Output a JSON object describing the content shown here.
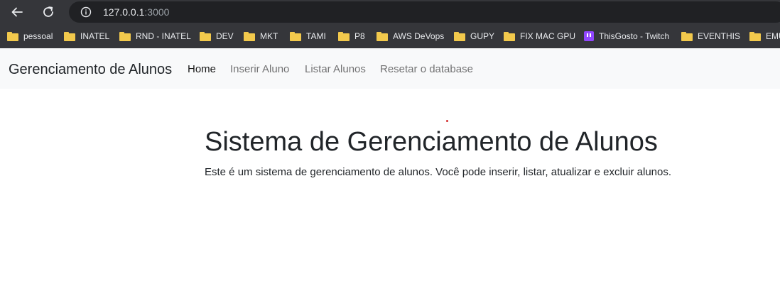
{
  "browser": {
    "url_host": "127.0.0.1",
    "url_port": ":3000",
    "bookmarks": [
      {
        "label": "pessoal",
        "icon": "folder-icon"
      },
      {
        "label": "INATEL",
        "icon": "folder-icon"
      },
      {
        "label": "RND - INATEL",
        "icon": "folder-icon"
      },
      {
        "label": "DEV",
        "icon": "folder-icon"
      },
      {
        "label": "MKT",
        "icon": "folder-icon"
      },
      {
        "label": "TAMI",
        "icon": "folder-icon"
      },
      {
        "label": "P8",
        "icon": "folder-icon"
      },
      {
        "label": "AWS DeVops",
        "icon": "folder-icon"
      },
      {
        "label": "GUPY",
        "icon": "folder-icon"
      },
      {
        "label": "FIX MAC GPU",
        "icon": "folder-icon"
      },
      {
        "label": "ThisGosto - Twitch",
        "icon": "twitch-icon"
      },
      {
        "label": "EVENTHIS",
        "icon": "folder-icon"
      },
      {
        "label": "EMU",
        "icon": "folder-icon"
      }
    ]
  },
  "navbar": {
    "brand": "Gerenciamento de Alunos",
    "links": [
      {
        "label": "Home",
        "active": true
      },
      {
        "label": "Inserir Aluno",
        "active": false
      },
      {
        "label": "Listar Alunos",
        "active": false
      },
      {
        "label": "Resetar o database",
        "active": false
      }
    ]
  },
  "main": {
    "title": "Sistema de Gerenciamento de Alunos",
    "description": "Este é um sistema de gerenciamento de alunos. Você pode inserir, listar, atualizar e excluir alunos."
  },
  "colors": {
    "chrome_bg": "#35363a",
    "omnibox_bg": "#202124",
    "navbar_bg": "#f8f9fa",
    "folder": "#f2c94c",
    "twitch": "#9146ff",
    "text": "#212529"
  }
}
